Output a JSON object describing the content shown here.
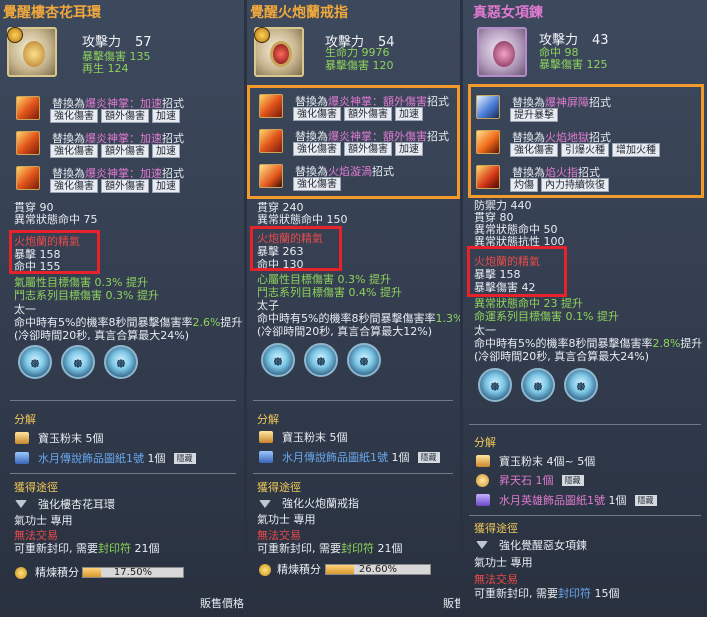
{
  "colors": {
    "title_orange": "#f0a83c",
    "title_pink": "#e07ad0",
    "stat_green": "#8ed35c",
    "highlight_red": "#e8222a",
    "highlight_orange": "#f39a2c"
  },
  "p1": {
    "title": "覺醒樓杏花耳環",
    "attack_label": "攻擊力",
    "attack_value": "57",
    "sub1": "暴擊傷害 135",
    "sub2": "再生 124",
    "skills": [
      {
        "prefix": "替換為",
        "name": "爆炎神掌：加速",
        "suffix": "招式",
        "buttons": [
          "強化傷害",
          "額外傷害",
          "加速"
        ]
      },
      {
        "prefix": "替換為",
        "name": "爆炎神掌：加速",
        "suffix": "招式",
        "buttons": [
          "強化傷害",
          "額外傷害",
          "加速"
        ]
      },
      {
        "prefix": "替換為",
        "name": "爆炎神掌：加速",
        "suffix": "招式",
        "buttons": [
          "強化傷害",
          "額外傷害",
          "加速"
        ]
      }
    ],
    "stat1": "貫穿 90",
    "stat2": "異常狀態命中 75",
    "essence_title": "火炮蘭的精氣",
    "essence_1": "暴擊  158",
    "essence_2": "命中  155",
    "bonus1": "氣屬性目標傷害  0.3%  提升",
    "bonus2": "鬥志系列目標傷害  0.3%  提升",
    "taiyi": "太一",
    "effect1a": "命中時有5%的機率8秒間暴擊傷害率",
    "effect1_pct": "2.6%",
    "effect1b": "提升",
    "effect2": "(冷卻時間20秒, 真言合算最大24%)",
    "gem_glyph": "᪥",
    "decompose_label": "分解",
    "mat1": "寶玉粉末  5個",
    "mat2_name": "水月傳說飾品圖紙1號",
    "mat2_qty": "1個",
    "mat2_badge": "隱藏",
    "obtain_label": "獲得途徑",
    "obtain1": "強化樓杏花耳環",
    "class_req": "氣功士  專用",
    "no_trade": "無法交易",
    "reseal_a": "可重新封印, 需要",
    "reseal_item": "封印符",
    "reseal_b": "21個",
    "refine_label": "精煉積分",
    "refine_pct": "17.50%",
    "refine_fraction": 0.175,
    "sell": "販售價格"
  },
  "p2": {
    "title": "覺醒火炮蘭戒指",
    "attack_label": "攻擊力",
    "attack_value": "54",
    "sub1": "生命力  9976",
    "sub2": "暴擊傷害 120",
    "skills": [
      {
        "prefix": "替換為",
        "name": "爆炎神掌：額外傷害",
        "suffix": "招式",
        "buttons": [
          "強化傷害",
          "額外傷害",
          "加速"
        ]
      },
      {
        "prefix": "替換為",
        "name": "爆炎神掌：額外傷害",
        "suffix": "招式",
        "buttons": [
          "強化傷害",
          "額外傷害",
          "加速"
        ]
      },
      {
        "prefix": "替換為",
        "name": "火焰漩渦",
        "suffix": "招式",
        "buttons": [
          "強化傷害"
        ]
      }
    ],
    "stat1": "貫穿 240",
    "stat2": "異常狀態命中 150",
    "essence_title": "火炮蘭的精氣",
    "essence_1": "暴擊  263",
    "essence_2": "命中  130",
    "bonus1": "心屬性目標傷害  0.3%  提升",
    "bonus2": "鬥志系列目標傷害  0.4%  提升",
    "taiyi": "太子",
    "effect1a": "命中時有5%的機率8秒間暴擊傷害率",
    "effect1_pct": "1.3%",
    "effect1b": "提升",
    "effect2": "(冷卻時間20秒, 真言合算最大12%)",
    "gem_glyph": "᪥",
    "decompose_label": "分解",
    "mat1": "寶玉粉末  5個",
    "mat2_name": "水月傳說飾品圖紙1號",
    "mat2_qty": "1個",
    "mat2_badge": "隱藏",
    "obtain_label": "獲得途徑",
    "obtain1": "強化火炮蘭戒指",
    "class_req": "氣功士  專用",
    "no_trade": "無法交易",
    "reseal_a": "可重新封印, 需要",
    "reseal_item": "封印符",
    "reseal_b": "21個",
    "refine_label": "精煉積分",
    "refine_pct": "26.60%",
    "refine_fraction": 0.266,
    "sell": "販售"
  },
  "p3": {
    "title": "真惡女項鍊",
    "attack_label": "攻擊力",
    "attack_value": "43",
    "sub1": "命中 98",
    "sub2": "暴擊傷害 125",
    "skills": [
      {
        "prefix": "替換為",
        "name": "爆神屏障",
        "suffix": "招式",
        "buttons": [
          "提升暴擊"
        ]
      },
      {
        "prefix": "替換為",
        "name": "火焰地獄",
        "suffix": "招式",
        "buttons": [
          "強化傷害",
          "引爆火種",
          "增加火種"
        ]
      },
      {
        "prefix": "替換為",
        "name": "焰火指",
        "suffix": "招式",
        "buttons": [
          "灼傷",
          "內力持續恢復"
        ]
      }
    ],
    "stat0": "防禦力  440",
    "stat1": "貫穿  80",
    "stat2": "異常狀態命中  50",
    "stat2b": "異常狀態抗性  100",
    "essence_title": "火炮蘭的精氣",
    "essence_1": "暴擊  158",
    "essence_2": "暴擊傷害  42",
    "stat3": "異常狀態命中  23  提升",
    "bonus2": "命運系列目標傷害  0.1%  提升",
    "taiyi": "太一",
    "effect1a": "命中時有5%的機率8秒間暴擊傷害率",
    "effect1_pct": "2.8%",
    "effect1b": "提升",
    "effect2": "(冷卻時間20秒, 真言合算最大24%)",
    "gem_glyph": "᪥",
    "decompose_label": "分解",
    "mat1": "寶玉粉末  4個~ 5個",
    "mat_extra": "昇天石  1個",
    "mat_extra_badge": "隱藏",
    "mat2_name": "水月英雄飾品圖紙1號",
    "mat2_qty": "1個",
    "mat2_badge": "隱藏",
    "obtain_label": "獲得途徑",
    "obtain1": "強化覺醒惡女項鍊",
    "class_req": "氣功士  專用",
    "no_trade": "無法交易",
    "reseal_a": "可重新封印, 需要",
    "reseal_item": "封印符",
    "reseal_b": "15個"
  }
}
